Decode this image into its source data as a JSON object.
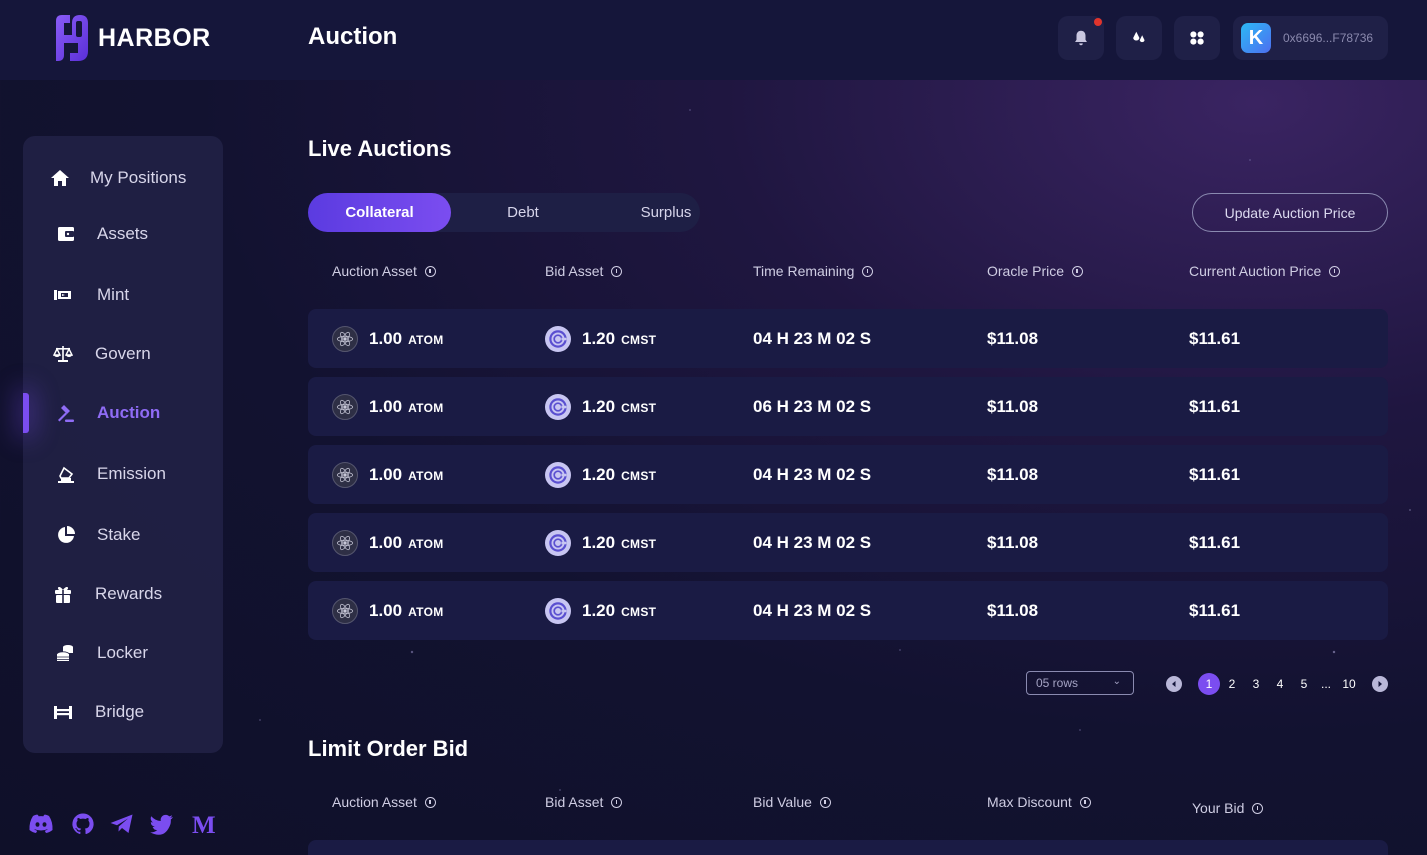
{
  "brand": {
    "name": "HARBOR"
  },
  "header": {
    "title": "Auction",
    "wallet": {
      "avatar_letter": "K",
      "address": "0x6696...F78736"
    },
    "colors": {
      "accent": "#7b4df0",
      "notification_dot": "#e0342c"
    }
  },
  "sidebar": {
    "items": [
      {
        "label": "My Positions",
        "icon": "home-icon"
      },
      {
        "label": "Assets",
        "icon": "wallet-icon"
      },
      {
        "label": "Mint",
        "icon": "mint-icon"
      },
      {
        "label": "Govern",
        "icon": "scales-icon"
      },
      {
        "label": "Auction",
        "icon": "gavel-icon",
        "active": true
      },
      {
        "label": "Emission",
        "icon": "emission-icon"
      },
      {
        "label": "Stake",
        "icon": "pie-icon"
      },
      {
        "label": "Rewards",
        "icon": "gift-icon"
      },
      {
        "label": "Locker",
        "icon": "coins-icon"
      },
      {
        "label": "Bridge",
        "icon": "bridge-icon"
      }
    ],
    "socials": [
      "discord-icon",
      "github-icon",
      "telegram-icon",
      "twitter-icon",
      "medium-icon"
    ]
  },
  "live_auctions": {
    "title": "Live Auctions",
    "tabs": [
      "Collateral",
      "Debt",
      "Surplus"
    ],
    "active_tab": "Collateral",
    "update_button": "Update Auction Price",
    "columns": [
      "Auction Asset",
      "Bid Asset",
      "Time Remaining",
      "Oracle Price",
      "Current Auction Price"
    ],
    "rows": [
      {
        "auction_amount": "1.00",
        "auction_unit": "ATOM",
        "bid_amount": "1.20",
        "bid_unit": "CMST",
        "time": "04 H 23 M 02 S",
        "oracle": "$11.08",
        "current": "$11.61"
      },
      {
        "auction_amount": "1.00",
        "auction_unit": "ATOM",
        "bid_amount": "1.20",
        "bid_unit": "CMST",
        "time": "06 H 23 M 02 S",
        "oracle": "$11.08",
        "current": "$11.61"
      },
      {
        "auction_amount": "1.00",
        "auction_unit": "ATOM",
        "bid_amount": "1.20",
        "bid_unit": "CMST",
        "time": "04 H 23 M 02 S",
        "oracle": "$11.08",
        "current": "$11.61"
      },
      {
        "auction_amount": "1.00",
        "auction_unit": "ATOM",
        "bid_amount": "1.20",
        "bid_unit": "CMST",
        "time": "04 H 23 M 02 S",
        "oracle": "$11.08",
        "current": "$11.61"
      },
      {
        "auction_amount": "1.00",
        "auction_unit": "ATOM",
        "bid_amount": "1.20",
        "bid_unit": "CMST",
        "time": "04 H 23 M 02 S",
        "oracle": "$11.08",
        "current": "$11.61"
      }
    ],
    "rows_select": "05 rows",
    "pagination": {
      "pages": [
        "1",
        "2",
        "3",
        "4",
        "5",
        "...",
        "10"
      ],
      "current": "1"
    }
  },
  "limit_order": {
    "title": "Limit Order Bid",
    "columns": [
      "Auction Asset",
      "Bid Asset",
      "Bid Value",
      "Max Discount",
      "Your Bid"
    ]
  }
}
